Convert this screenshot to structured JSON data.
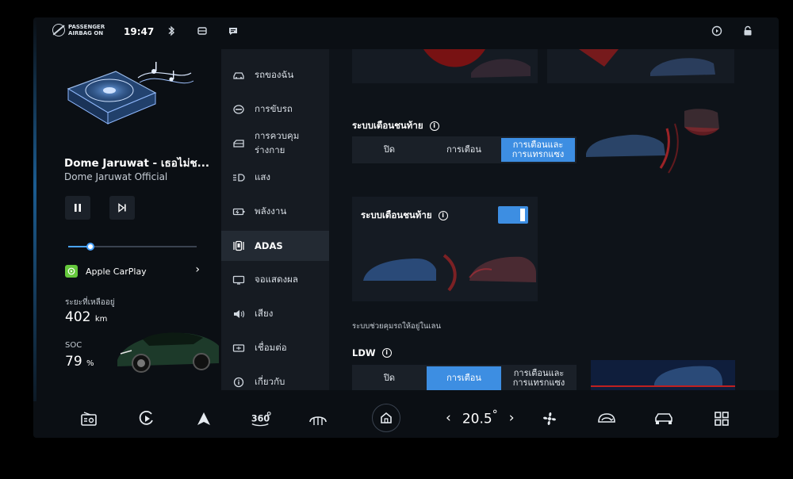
{
  "status": {
    "airbag_line1": "PASSENGER",
    "airbag_line2": "AIRBAG ON",
    "time": "19:47"
  },
  "media": {
    "title": "Dome Jaruwat - เธอไม่ช...",
    "artist": "Dome Jaruwat Official",
    "progress": 0.17,
    "source_label": "Apple CarPlay"
  },
  "vehicle": {
    "range_label": "ระยะที่เหลืออยู่",
    "range_value": "402",
    "range_unit": "km",
    "soc_label": "SOC",
    "soc_value": "79",
    "soc_unit": "%"
  },
  "nav": {
    "items": [
      {
        "label": "รถของฉัน",
        "icon": "car-icon"
      },
      {
        "label": "การขับรถ",
        "icon": "steering-wheel-icon"
      },
      {
        "label": "การควบคุมร่างกาย",
        "icon": "car-body-icon"
      },
      {
        "label": "แสง",
        "icon": "headlight-icon"
      },
      {
        "label": "พลังงาน",
        "icon": "battery-icon"
      },
      {
        "label": "ADAS",
        "icon": "adas-icon",
        "active": true
      },
      {
        "label": "จอแสดงผล",
        "icon": "display-icon"
      },
      {
        "label": "เสียง",
        "icon": "speaker-icon"
      },
      {
        "label": "เชื่อมต่อ",
        "icon": "connect-icon"
      },
      {
        "label": "เกี่ยวกับ",
        "icon": "info-icon"
      }
    ]
  },
  "adas": {
    "rear_warning": {
      "title": "ระบบเตือนชนท้าย",
      "options": [
        "ปิด",
        "การเตือน",
        "การเตือนและ\nการแทรกแซง"
      ],
      "selected": 2
    },
    "rear_warning_toggle": {
      "title": "ระบบเตือนชนท้าย",
      "enabled": true
    },
    "lane_caption": "ระบบช่วยคุมรถให้อยู่ในเลน",
    "ldw": {
      "title": "LDW",
      "options": [
        "ปิด",
        "การเตือน",
        "การเตือนและ\nการแทรกแซง"
      ],
      "selected": 1
    }
  },
  "climate": {
    "temperature": "20.5",
    "unit": "°"
  },
  "colors": {
    "accent": "#3d8ee2",
    "background": "#0b0f14",
    "panel": "#151b23"
  }
}
